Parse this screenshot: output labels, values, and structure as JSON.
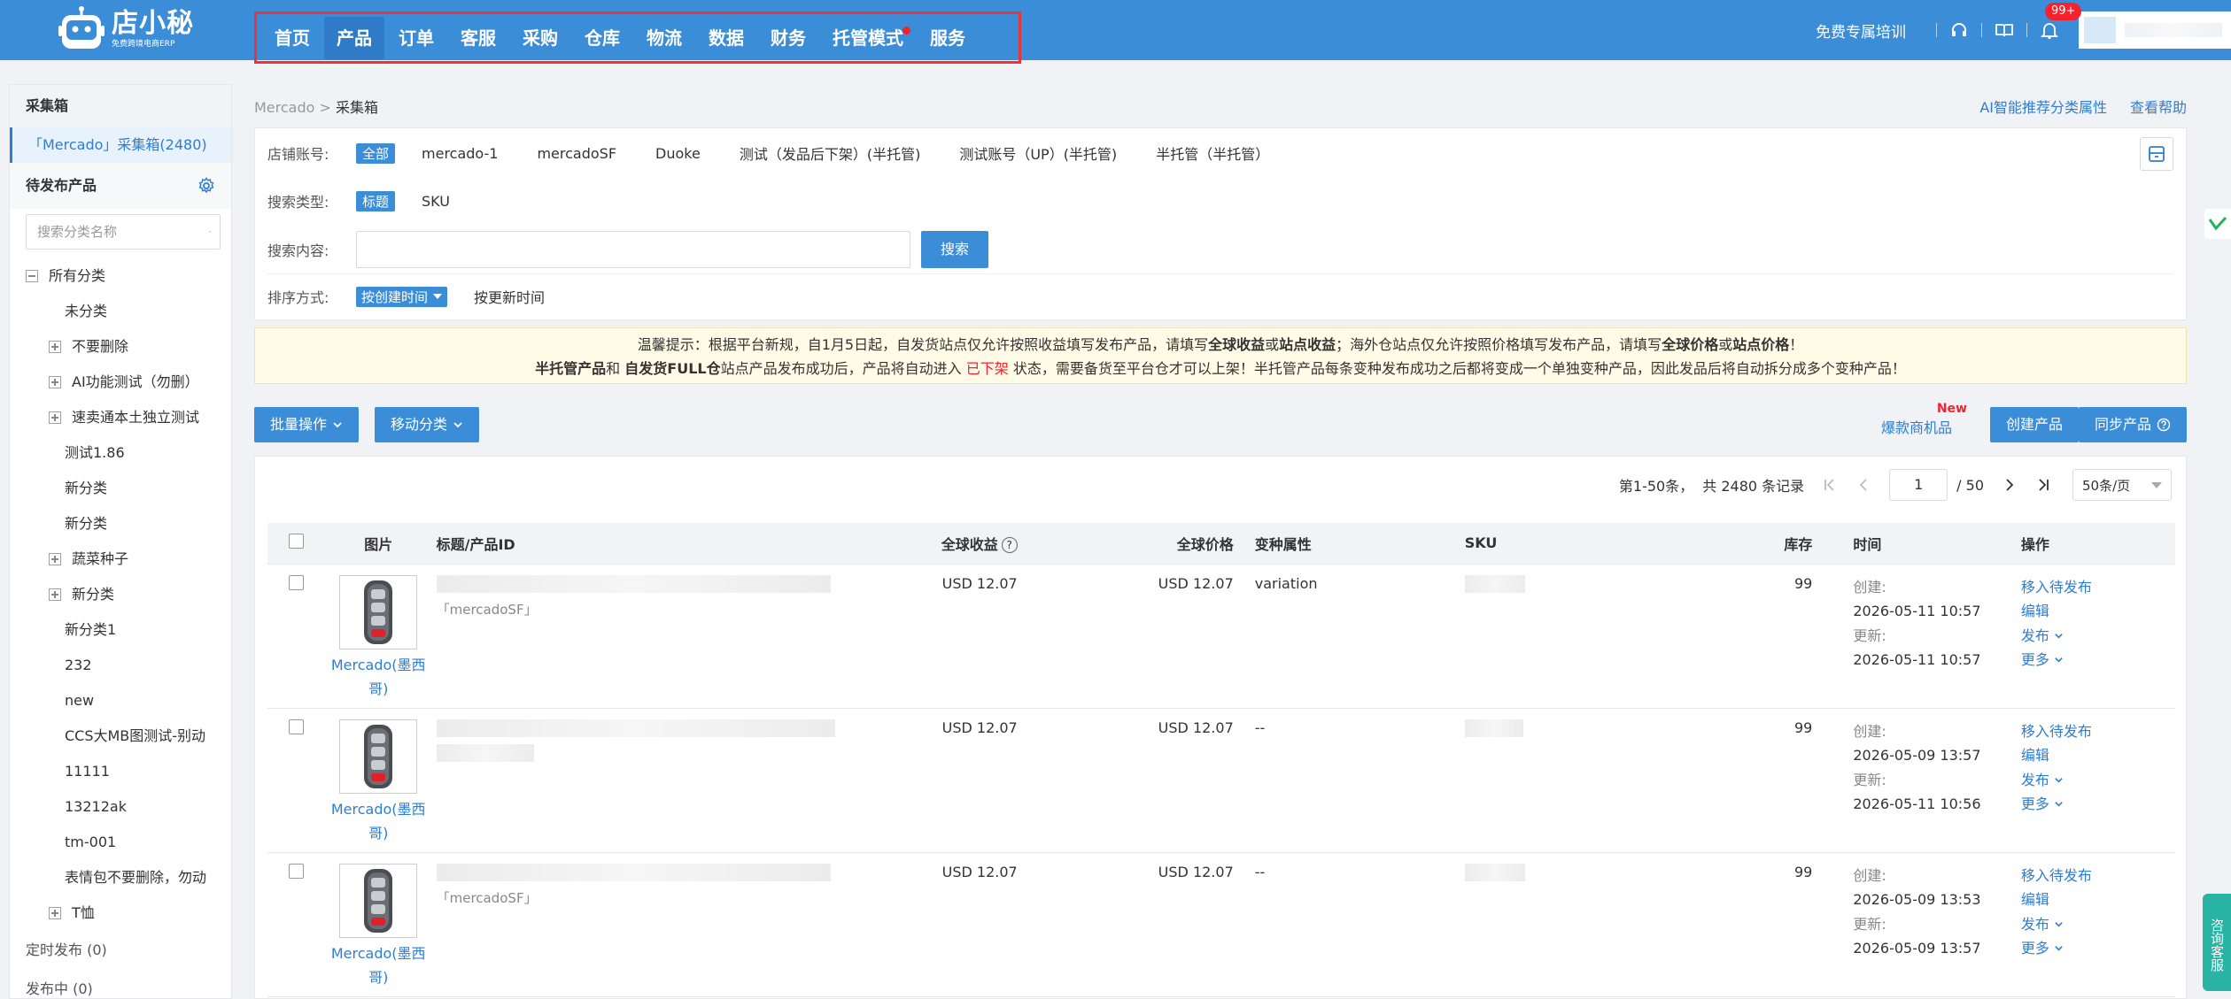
{
  "brand": {
    "name": "店小秘",
    "tagline": "免费跨境电商ERP"
  },
  "nav": {
    "items": [
      {
        "label": "首页"
      },
      {
        "label": "产品"
      },
      {
        "label": "订单"
      },
      {
        "label": "客服"
      },
      {
        "label": "采购"
      },
      {
        "label": "仓库"
      },
      {
        "label": "物流"
      },
      {
        "label": "数据"
      },
      {
        "label": "财务"
      },
      {
        "label": "托管模式"
      },
      {
        "label": "服务"
      }
    ],
    "active_index": 1
  },
  "topright": {
    "training": "免费专属培训",
    "notification_count": "99+"
  },
  "sidebar": {
    "header": "采集箱",
    "box_item": "「Mercado」采集箱(2480)",
    "pending_title": "待发布产品",
    "search_placeholder": "搜索分类名称",
    "tree": [
      {
        "label": "所有分类",
        "level": 0,
        "toggle": "minus"
      },
      {
        "label": "未分类",
        "level": 1,
        "toggle": "none"
      },
      {
        "label": "不要删除",
        "level": 1,
        "toggle": "plus"
      },
      {
        "label": "AI功能测试（勿删）",
        "level": 1,
        "toggle": "plus"
      },
      {
        "label": "速卖通本土独立测试",
        "level": 1,
        "toggle": "plus"
      },
      {
        "label": "测试1.86",
        "level": 1,
        "toggle": "none"
      },
      {
        "label": "新分类",
        "level": 1,
        "toggle": "none"
      },
      {
        "label": "新分类",
        "level": 1,
        "toggle": "none"
      },
      {
        "label": "蔬菜种子",
        "level": 1,
        "toggle": "plus"
      },
      {
        "label": "新分类",
        "level": 1,
        "toggle": "plus"
      },
      {
        "label": "新分类1",
        "level": 1,
        "toggle": "none"
      },
      {
        "label": "232",
        "level": 1,
        "toggle": "none"
      },
      {
        "label": "new",
        "level": 1,
        "toggle": "none"
      },
      {
        "label": "CCS大MB图测试-别动",
        "level": 1,
        "toggle": "none"
      },
      {
        "label": "11111",
        "level": 1,
        "toggle": "none"
      },
      {
        "label": "13212ak",
        "level": 1,
        "toggle": "none"
      },
      {
        "label": "tm-001",
        "level": 1,
        "toggle": "none"
      },
      {
        "label": "表情包不要删除，勿动",
        "level": 1,
        "toggle": "none"
      },
      {
        "label": "T恤",
        "level": 1,
        "toggle": "plus"
      }
    ],
    "scheduled": "定时发布 (0)",
    "publishing": "发布中 (0)"
  },
  "breadcrumb": {
    "root": "Mercado",
    "sep": ">",
    "current": "采集箱"
  },
  "top_links": {
    "ai": "AI智能推荐分类属性",
    "help": "查看帮助"
  },
  "filters": {
    "shop_label": "店铺账号:",
    "shop_all": "全部",
    "shops": [
      "mercado-1",
      "mercadoSF",
      "Duoke",
      "测试（发品后下架）(半托管)",
      "测试账号（UP）(半托管)",
      "半托管（半托管）"
    ],
    "type_label": "搜索类型:",
    "type_active": "标题",
    "type_other": "SKU",
    "content_label": "搜索内容:",
    "content_value": "",
    "search_button": "搜索",
    "sort_label": "排序方式:",
    "sort_active": "按创建时间",
    "sort_other": "按更新时间"
  },
  "notice": {
    "l1_a": "温馨提示：根据平台新规，自1月5日起，自发货站点仅允许按照收益填写发布产品，请填写",
    "l1_b": "全球收益",
    "l1_c": "或",
    "l1_d": "站点收益",
    "l1_e": "；海外仓站点仅允许按照价格填写发布产品，请填写",
    "l1_f": "全球价格",
    "l1_g": "或",
    "l1_h": "站点价格",
    "l1_i": "！",
    "l2_a": "半托管产品",
    "l2_b": "和",
    "l2_c": "自发货FULL仓",
    "l2_d": "站点产品发布成功后，产品将自动进入",
    "l2_e": "已下架",
    "l2_f": "状态，需要备货至平台仓才可以上架！半托管产品每条变种发布成功之后都将变成一个单独变种产品，因此发品后将自动拆分成多个变种产品！"
  },
  "actions": {
    "batch": "批量操作",
    "move": "移动分类",
    "hot": "爆款商机品",
    "new_badge": "New",
    "create": "创建产品",
    "sync": "同步产品"
  },
  "pager": {
    "range": "第1-50条，",
    "total": "共 2480 条记录",
    "page": "1",
    "pages": "/ 50",
    "size": "50条/页"
  },
  "table": {
    "headers": {
      "image": "图片",
      "title": "标题/产品ID",
      "revenue": "全球收益",
      "price": "全球价格",
      "variant": "变种属性",
      "sku": "SKU",
      "stock": "库存",
      "time": "时间",
      "ops": "操作"
    },
    "rows": [
      {
        "store": "Mercado(墨西哥)",
        "shop_tag": "「mercadoSF」",
        "revenue": "USD 12.07",
        "price": "USD 12.07",
        "variant": "variation",
        "stock": "99",
        "created_label": "创建:",
        "created": "2026-05-11 10:57",
        "updated_label": "更新:",
        "updated": "2026-05-11 10:57"
      },
      {
        "store": "Mercado(墨西哥)",
        "shop_tag": "",
        "revenue": "USD 12.07",
        "price": "USD 12.07",
        "variant": "--",
        "stock": "99",
        "created_label": "创建:",
        "created": "2026-05-09 13:57",
        "updated_label": "更新:",
        "updated": "2026-05-11 10:56"
      },
      {
        "store": "Mercado(墨西哥)",
        "shop_tag": "「mercadoSF」",
        "revenue": "USD 12.07",
        "price": "USD 12.07",
        "variant": "--",
        "stock": "99",
        "created_label": "创建:",
        "created": "2026-05-09 13:53",
        "updated_label": "更新:",
        "updated": "2026-05-09 13:57"
      }
    ],
    "ops": {
      "move": "移入待发布",
      "edit": "编辑",
      "publish": "发布",
      "more": "更多"
    }
  },
  "float": {
    "service": "咨询客服"
  },
  "colors": {
    "primary": "#3c8dd8",
    "link": "#2f7dd1",
    "danger": "#f5222d",
    "notice_bg": "#fffbe6",
    "nav_highlight": "#e9343e"
  }
}
